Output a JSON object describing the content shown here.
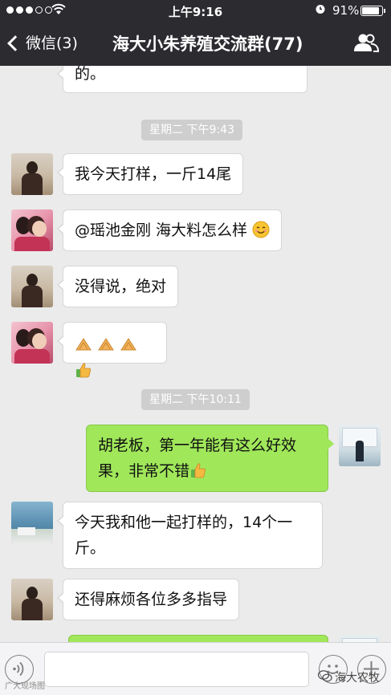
{
  "status_bar": {
    "time": "上午9:16",
    "battery": "91%",
    "battery_fraction": 0.91
  },
  "nav": {
    "back_label": "微信(3)",
    "title": "海大小朱养殖交流群(77)"
  },
  "messages": [
    {
      "side": "left",
      "avatar": "man-portrait",
      "text": "的。"
    },
    {
      "type": "time",
      "text": "星期二 下午9:43"
    },
    {
      "side": "left",
      "avatar": "man-portrait",
      "text": "我今天打样，一斤14尾"
    },
    {
      "side": "left",
      "avatar": "couple-portrait",
      "text": "@瑶池金刚 海大料怎么样",
      "emoji": "smile-emoji"
    },
    {
      "side": "left",
      "avatar": "man-portrait",
      "text": "没得说，绝对"
    },
    {
      "side": "left",
      "avatar": "couple-portrait",
      "text": "",
      "emoji": [
        "clap-emoji",
        "clap-emoji",
        "clap-emoji",
        "thumbs-up-emoji"
      ]
    },
    {
      "type": "time",
      "text": "星期二 下午10:11"
    },
    {
      "side": "right",
      "avatar": "office-portrait",
      "lines": [
        "胡老板，第一年能有这么好效",
        "果，非常不错"
      ],
      "emoji": "thumbs-up-emoji"
    },
    {
      "side": "left",
      "avatar": "seaside-photo",
      "lines": [
        "今天我和他一起打样的，14个一",
        "斤。"
      ]
    },
    {
      "side": "left",
      "avatar": "man-portrait",
      "text": "还得麻烦各位多多指导"
    }
  ],
  "watermark": {
    "left": "广大现场图",
    "right": "海大农牧"
  },
  "colors": {
    "bar": "#2b2b30",
    "chat_bg": "#ebebeb",
    "sent_bubble": "#a0e75a",
    "received_bubble": "#ffffff"
  }
}
